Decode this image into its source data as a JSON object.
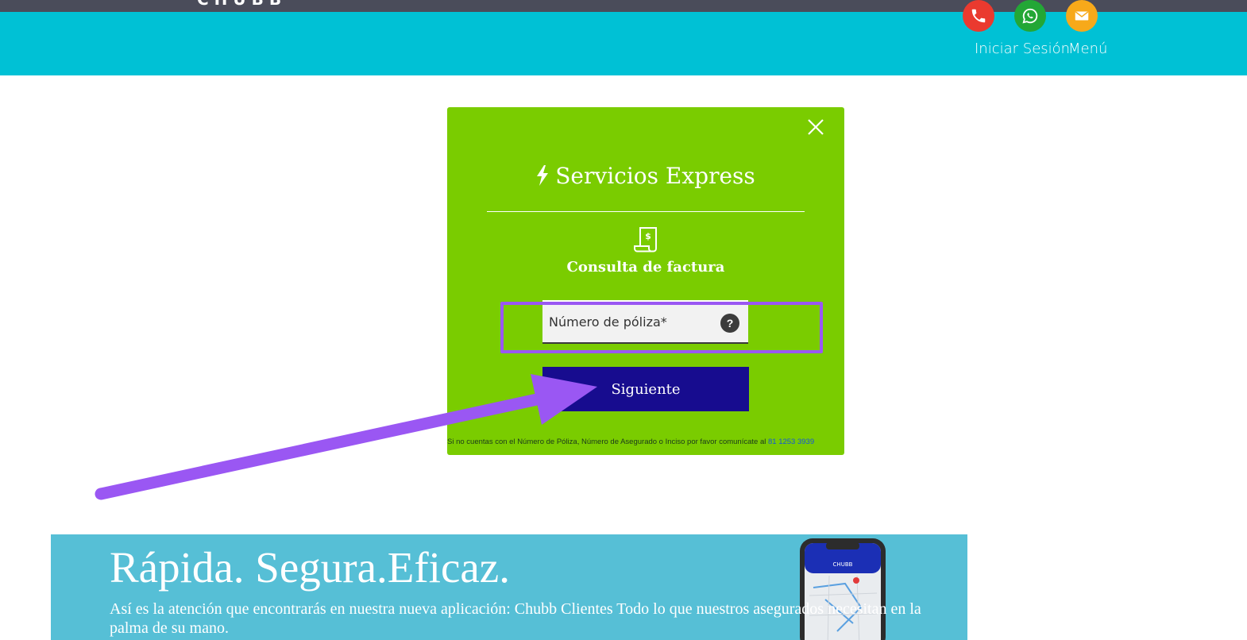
{
  "header": {
    "logo": "CHUBB",
    "login_label": "Iniciar Sesión",
    "menu_label": "Menú",
    "icons": [
      "phone-icon",
      "whatsapp-icon",
      "mail-icon"
    ],
    "colors": {
      "header_bg": "#00c1d5",
      "topbar_bg": "#4a4c5a",
      "phone": "#ea3a2f",
      "whatsapp": "#23a736",
      "mail": "#f7a91a"
    }
  },
  "modal": {
    "title": "Servicios Express",
    "subtitle": "Consulta de factura",
    "policy_placeholder": "Número de póliza*",
    "help_label": "?",
    "next_label": "Siguiente",
    "footnote_text": "Si no cuentas con el Número de Póliza, Número de Asegurado o Inciso por favor comunícate al",
    "footnote_phone": "81 1253 3939",
    "colors": {
      "bg": "#7acc00",
      "button": "#170c8f",
      "annotation": "#9a57f3"
    }
  },
  "banner": {
    "title": "Rápida. Segura.Eficaz.",
    "text": "Así es la atención que encontrarás en nuestra nueva aplicación: Chubb Clientes Todo lo que nuestros asegurados necesitan en la palma de su mano.",
    "phone_logo": "CHUBB"
  }
}
